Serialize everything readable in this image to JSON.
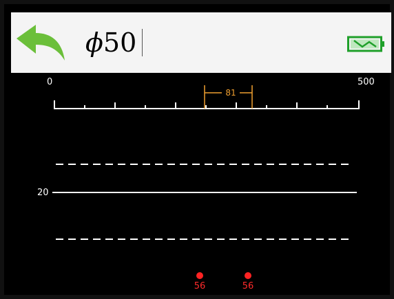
{
  "header": {
    "back_icon": "back-arrow-icon",
    "diameter_symbol": "ϕ",
    "diameter_value": "50",
    "battery_icon": "battery-charging-icon",
    "accent_color": "#6bbf3a",
    "battery_color": "#1fa02a"
  },
  "scale": {
    "min_label": "0",
    "max_label": "500",
    "measurement_label": "81",
    "measurement_color": "#f0a030"
  },
  "plot": {
    "baseline_label": "20",
    "markers": [
      {
        "label": "56"
      },
      {
        "label": "56"
      }
    ],
    "marker_color": "#ff2222"
  }
}
